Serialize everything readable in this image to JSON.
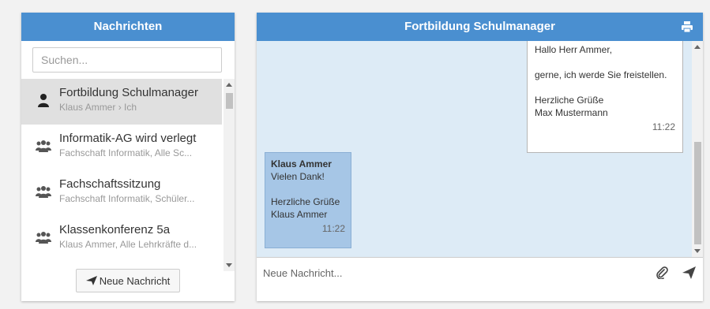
{
  "sidebar": {
    "title": "Nachrichten",
    "search_placeholder": "Suchen...",
    "conversations": [
      {
        "title": "Fortbildung Schulmanager",
        "subtitle": "Klaus Ammer › Ich",
        "icon": "user-icon",
        "active": true
      },
      {
        "title": "Informatik-AG wird verlegt",
        "subtitle": "Fachschaft Informatik, Alle Sc...",
        "icon": "group-icon",
        "active": false
      },
      {
        "title": "Fachschaftssitzung",
        "subtitle": "Fachschaft Informatik, Schüler...",
        "icon": "group-icon",
        "active": false
      },
      {
        "title": "Klassenkonferenz 5a",
        "subtitle": "Klaus Ammer, Alle Lehrkräfte d...",
        "icon": "group-icon",
        "active": false
      }
    ],
    "new_message_label": "Neue Nachricht"
  },
  "chat": {
    "title": "Fortbildung Schulmanager",
    "messages": {
      "outgoing": {
        "line1": "Hallo Herr Ammer,",
        "line2": "gerne, ich werde Sie freistellen.",
        "line3": "Herzliche Grüße",
        "line4": "Max Mustermann",
        "time": "11:22"
      },
      "incoming": {
        "sender": "Klaus Ammer",
        "line1": "Vielen Dank!",
        "line2": "Herzliche Grüße",
        "line3": "Klaus Ammer",
        "time": "11:22"
      }
    },
    "compose_placeholder": "Neue Nachricht..."
  },
  "colors": {
    "header": "#4a8fd0",
    "chat_background": "#ddebf6",
    "incoming_bubble": "#a6c6e6",
    "active_item": "#e0e0e0"
  }
}
